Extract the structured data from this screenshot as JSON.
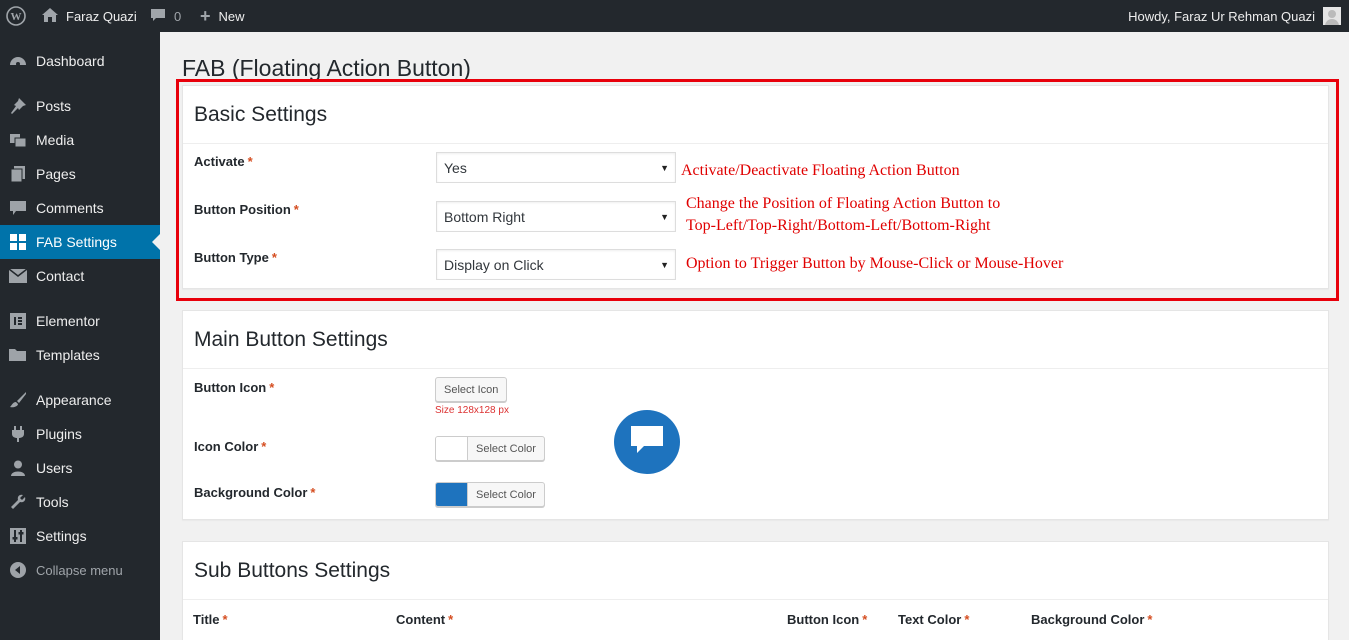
{
  "adminbar": {
    "site_name": "Faraz Quazi",
    "comments_count": "0",
    "new_label": "New",
    "howdy": "Howdy, Faraz Ur Rehman Quazi"
  },
  "sidebar": {
    "items": [
      {
        "label": "Dashboard",
        "icon": "dashboard-icon"
      },
      {
        "label": "Posts",
        "icon": "pin-icon"
      },
      {
        "label": "Media",
        "icon": "media-icon"
      },
      {
        "label": "Pages",
        "icon": "pages-icon"
      },
      {
        "label": "Comments",
        "icon": "comment-icon"
      },
      {
        "label": "FAB Settings",
        "icon": "grid-icon"
      },
      {
        "label": "Contact",
        "icon": "mail-icon"
      },
      {
        "label": "Elementor",
        "icon": "elementor-icon"
      },
      {
        "label": "Templates",
        "icon": "folder-icon"
      },
      {
        "label": "Appearance",
        "icon": "brush-icon"
      },
      {
        "label": "Plugins",
        "icon": "plug-icon"
      },
      {
        "label": "Users",
        "icon": "user-icon"
      },
      {
        "label": "Tools",
        "icon": "wrench-icon"
      },
      {
        "label": "Settings",
        "icon": "sliders-icon"
      },
      {
        "label": "Collapse menu",
        "icon": "collapse-icon"
      }
    ],
    "active_color": "#0073aa"
  },
  "page": {
    "title": "FAB (Floating Action Button)"
  },
  "basic": {
    "title": "Basic Settings",
    "activate_label": "Activate",
    "activate_value": "Yes",
    "position_label": "Button Position",
    "position_value": "Bottom Right",
    "type_label": "Button Type",
    "type_value": "Display on Click",
    "required": "*"
  },
  "annotations": {
    "activate_note": "Activate/Deactivate Floating Action Button",
    "position_note_1": "Change the Position of Floating Action Button to",
    "position_note_2": "Top-Left/Top-Right/Bottom-Left/Bottom-Right",
    "type_note": "Option to Trigger Button by Mouse-Click or Mouse-Hover",
    "color": "#e8000b"
  },
  "main": {
    "title": "Main Button Settings",
    "icon_label": "Button Icon",
    "select_icon": "Select Icon",
    "size_hint": "Size 128x128 px",
    "icon_color_label": "Icon Color",
    "select_color": "Select Color",
    "bg_color_label": "Background Color",
    "icon_color_value": "#ffffff",
    "bg_color_value": "#1e73be"
  },
  "sub": {
    "title": "Sub Buttons Settings",
    "columns": [
      "Title",
      "Content",
      "Button Icon",
      "Text Color",
      "Background Color"
    ]
  }
}
